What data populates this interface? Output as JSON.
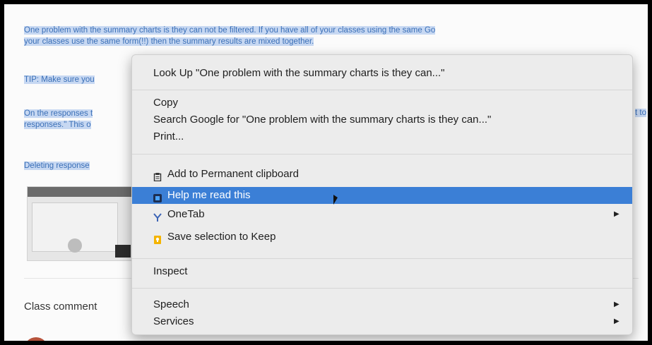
{
  "document": {
    "line1": "One problem with the summary charts is they can not be filtered. If you have all of your classes using the same Go",
    "line2": "your classes use the same form(!!) then the summary results are mixed together.",
    "tip": "TIP: Make sure you",
    "line3": "On the responses t",
    "line3_right": "t to",
    "line4": "responses.\" This o",
    "line5": "Deleting response",
    "class_comments": "Class comment"
  },
  "context_menu": {
    "look_up": "Look Up \"One problem with the summary charts is they can...\"",
    "copy": "Copy",
    "search_google": "Search Google for \"One problem with the summary charts is they can...\"",
    "print": "Print...",
    "add_clipboard": "Add to Permanent clipboard",
    "help_read": "Help me read this",
    "onetab": "OneTab",
    "save_keep": "Save selection to Keep",
    "inspect": "Inspect",
    "speech": "Speech",
    "services": "Services"
  },
  "colors": {
    "highlight": "#3b7fd6",
    "selection": "#c7d8f2",
    "link_text": "#3a6fb7"
  }
}
